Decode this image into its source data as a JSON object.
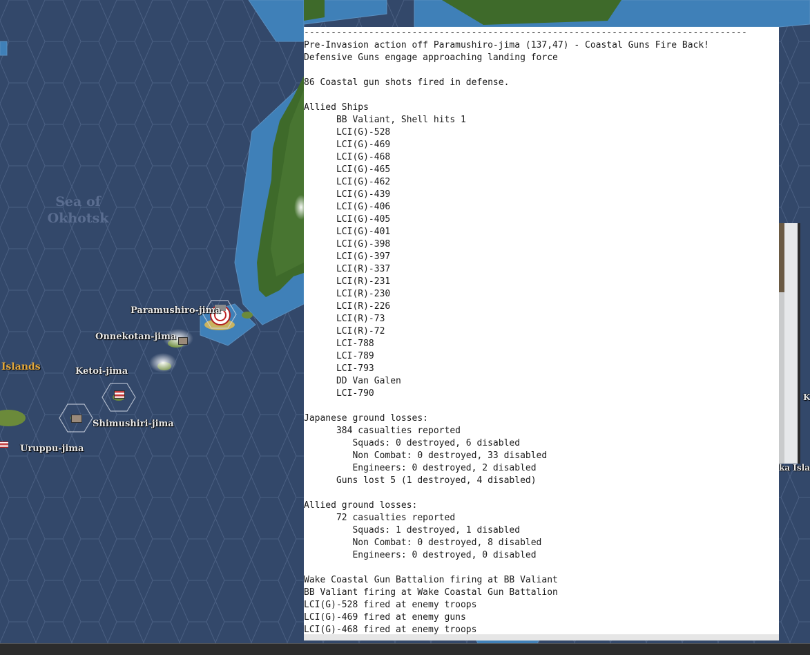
{
  "map": {
    "sea_label": "Sea of\nOkhotsk",
    "region_label": "Islands",
    "right_label_fragment": "ka Island",
    "right_edge_letter": "K",
    "bases": [
      {
        "name": "Paramushiro-jima"
      },
      {
        "name": "Onnekotan-jima"
      },
      {
        "name": "Ketoi-jima"
      },
      {
        "name": "Shimushiri-jima"
      },
      {
        "name": "Uruppu-jima"
      }
    ]
  },
  "report": {
    "lines": [
      "----------------------------------------------------------------------------------",
      "Pre-Invasion action off Paramushiro-jima (137,47) - Coastal Guns Fire Back!",
      "Defensive Guns engage approaching landing force",
      "",
      "86 Coastal gun shots fired in defense.",
      "",
      "Allied Ships",
      "      BB Valiant, Shell hits 1",
      "      LCI(G)-528",
      "      LCI(G)-469",
      "      LCI(G)-468",
      "      LCI(G)-465",
      "      LCI(G)-462",
      "      LCI(G)-439",
      "      LCI(G)-406",
      "      LCI(G)-405",
      "      LCI(G)-401",
      "      LCI(G)-398",
      "      LCI(G)-397",
      "      LCI(R)-337",
      "      LCI(R)-231",
      "      LCI(R)-230",
      "      LCI(R)-226",
      "      LCI(R)-73",
      "      LCI(R)-72",
      "      LCI-788",
      "      LCI-789",
      "      LCI-793",
      "      DD Van Galen",
      "      LCI-790",
      "",
      "Japanese ground losses:",
      "      384 casualties reported",
      "         Squads: 0 destroyed, 6 disabled",
      "         Non Combat: 0 destroyed, 33 disabled",
      "         Engineers: 0 destroyed, 2 disabled",
      "      Guns lost 5 (1 destroyed, 4 disabled)",
      "",
      "Allied ground losses:",
      "      72 casualties reported",
      "         Squads: 1 destroyed, 1 disabled",
      "         Non Combat: 0 destroyed, 8 disabled",
      "         Engineers: 0 destroyed, 0 disabled",
      "",
      "Wake Coastal Gun Battalion firing at BB Valiant",
      "BB Valiant firing at Wake Coastal Gun Battalion",
      "LCI(G)-528 fired at enemy troops",
      "LCI(G)-469 fired at enemy guns",
      "LCI(G)-468 fired at enemy troops"
    ]
  },
  "colors": {
    "ocean": "#33486a",
    "hex_line": "#4a5f82",
    "shallow": "#3e7fb5",
    "land": "#3f6a2c",
    "report_bg": "#ffffff"
  }
}
